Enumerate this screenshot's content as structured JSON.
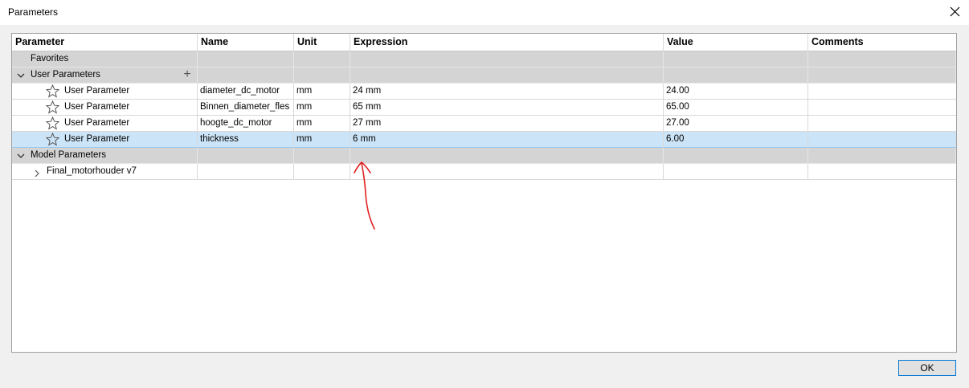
{
  "window": {
    "title": "Parameters",
    "close_icon": "close-icon"
  },
  "columns": [
    "Parameter",
    "Name",
    "Unit",
    "Expression",
    "Value",
    "Comments"
  ],
  "groups": {
    "favorites": "Favorites",
    "user_parameters": "User Parameters",
    "model_parameters": "Model Parameters"
  },
  "user_parameters": [
    {
      "type": "User Parameter",
      "name": "diameter_dc_motor",
      "unit": "mm",
      "expression": "24 mm",
      "value": "24.00",
      "comments": "",
      "selected": false
    },
    {
      "type": "User Parameter",
      "name": "Binnen_diameter_fles",
      "unit": "mm",
      "expression": "65 mm",
      "value": "65.00",
      "comments": "",
      "selected": false
    },
    {
      "type": "User Parameter",
      "name": "hoogte_dc_motor",
      "unit": "mm",
      "expression": "27 mm",
      "value": "27.00",
      "comments": "",
      "selected": false
    },
    {
      "type": "User Parameter",
      "name": "thickness",
      "unit": "mm",
      "expression": "6 mm",
      "value": "6.00",
      "comments": "",
      "selected": true
    }
  ],
  "model_parameters": [
    {
      "label": "Final_motorhouder v7"
    }
  ],
  "buttons": {
    "ok": "OK",
    "add": "+"
  },
  "annotation": {
    "color": "#e02020"
  },
  "colors": {
    "selection": "#cce4f7",
    "group_row": "#d4d4d4",
    "ok_border": "#0078d7"
  }
}
